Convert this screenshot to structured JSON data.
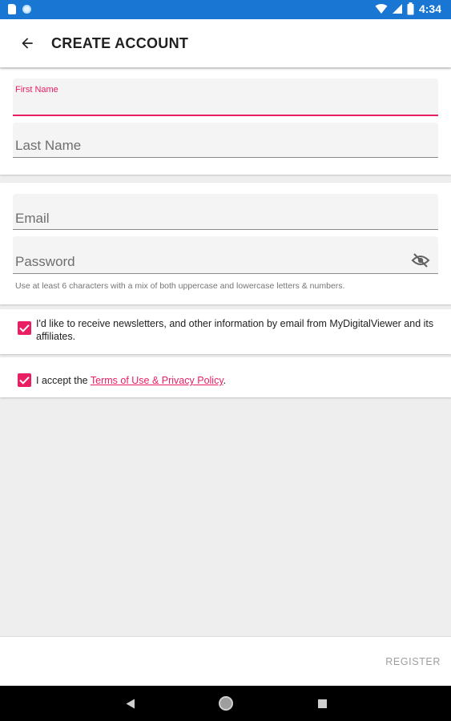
{
  "status_bar": {
    "time": "4:34",
    "icons": [
      "sd-card-icon",
      "sync-icon",
      "wifi-icon",
      "signal-icon",
      "battery-icon"
    ]
  },
  "app_bar": {
    "title": "CREATE ACCOUNT",
    "back_icon": "arrow-left-icon"
  },
  "form": {
    "first_name": {
      "label": "First Name",
      "value": ""
    },
    "last_name": {
      "placeholder": "Last Name",
      "value": ""
    },
    "email": {
      "placeholder": "Email",
      "value": ""
    },
    "password": {
      "placeholder": "Password",
      "value": "",
      "toggle_icon": "eye-off-icon"
    },
    "password_helper": "Use at least 6 characters with a mix of both uppercase and lowercase letters & numbers."
  },
  "consents": {
    "newsletter": {
      "checked": true,
      "text": "I'd like to receive newsletters, and other information by email from MyDigitalViewer and its affiliates."
    },
    "terms": {
      "checked": true,
      "prefix": "I accept the ",
      "link": "Terms of Use & Privacy Policy",
      "suffix": "."
    }
  },
  "actions": {
    "register_label": "REGISTER"
  },
  "colors": {
    "accent": "#e91e63",
    "status_bar": "#1976d2",
    "background": "#eeeeee"
  }
}
